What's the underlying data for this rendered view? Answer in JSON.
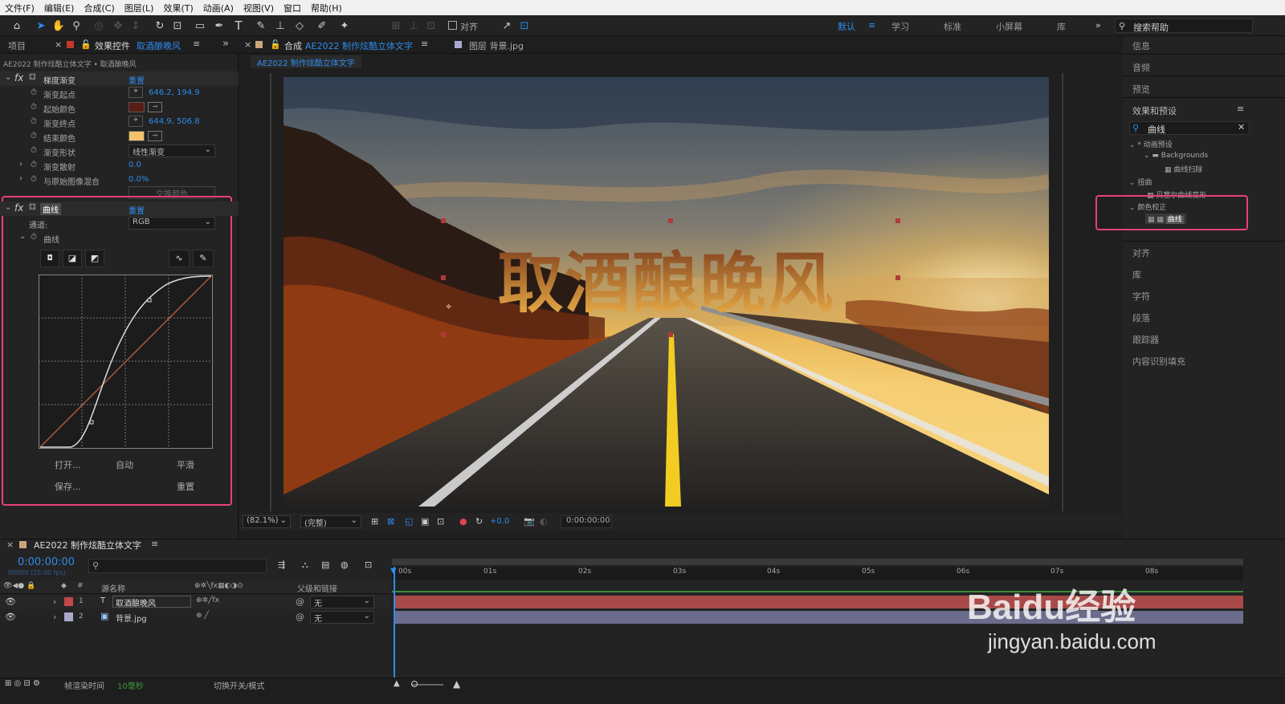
{
  "menu": [
    "文件(F)",
    "编辑(E)",
    "合成(C)",
    "图层(L)",
    "效果(T)",
    "动画(A)",
    "视图(V)",
    "窗口",
    "帮助(H)"
  ],
  "toolbar": {
    "align_label": "对齐",
    "workspaces": [
      "默认",
      "学习",
      "标准",
      "小屏幕",
      "库"
    ],
    "search_placeholder": "搜索帮助"
  },
  "left_panel": {
    "tab_project": "项目",
    "tab_effects": "效果控件",
    "layer_name": "取酒酿晚风",
    "breadcrumb": "AE2022 制作炫酷立体文字 • 取酒酿晚风",
    "ramp": {
      "name": "梯度渐变",
      "reset": "重置",
      "props": [
        {
          "label": "渐变起点",
          "value": "646.2, 194.9"
        },
        {
          "label": "起始颜色",
          "value": ""
        },
        {
          "label": "渐变终点",
          "value": "644.9, 506.8"
        },
        {
          "label": "结束颜色",
          "value": ""
        },
        {
          "label": "渐变形状",
          "value": "线性渐变"
        },
        {
          "label": "渐变散射",
          "value": "0.0"
        },
        {
          "label": "与原始图像混合",
          "value": "0.0%"
        }
      ],
      "swap_button": "交换颜色",
      "start_color": "#5a1d15",
      "end_color": "#f2c46a"
    },
    "curves": {
      "name": "曲线",
      "reset": "重置",
      "channel_label": "通道:",
      "channel_value": "RGB",
      "curve_label": "曲线",
      "buttons": [
        "打开...",
        "自动",
        "平滑",
        "保存...",
        "重置"
      ]
    }
  },
  "viewer": {
    "tab_comp_prefix": "合成",
    "tab_comp_name": "AE2022 制作炫酷立体文字",
    "tab_layer": "图层 背景.jpg",
    "comp_tag": "AE2022 制作炫酷立体文字",
    "title_text": "取酒酿晚风",
    "zoom": "(82.1%)",
    "resolution": "(完整)",
    "exposure": "+0.0",
    "timecode": "0:00:00:00"
  },
  "right_panel": {
    "sections": [
      "信息",
      "音频",
      "预览"
    ],
    "effects_title": "效果和预设",
    "search_value": "曲线",
    "tree": [
      {
        "label": "* 动画预设",
        "indent": 0
      },
      {
        "label": "Backgrounds",
        "indent": 1
      },
      {
        "label": "曲线扫除",
        "indent": 2
      },
      {
        "label": "扭曲",
        "indent": 0
      },
      {
        "label": "贝塞尔曲线变形",
        "indent": 2
      },
      {
        "label": "颜色校正",
        "indent": 0
      },
      {
        "label": "曲线",
        "indent": 2
      }
    ],
    "bottom_sections": [
      "对齐",
      "库",
      "字符",
      "段落",
      "跟踪器",
      "内容识别填充"
    ]
  },
  "timeline": {
    "comp_name": "AE2022 制作炫酷立体文字",
    "timecode": "0:00:00:00",
    "frame_info": "00000 (25.00 fps)",
    "col_source": "源名称",
    "col_parent": "父级和链接",
    "layers": [
      {
        "num": "1",
        "type": "T",
        "name": "取酒酿晚风",
        "parent": "无",
        "color": "#c04848"
      },
      {
        "num": "2",
        "type": "img",
        "name": "背景.jpg",
        "parent": "无",
        "color": "#a9a9d0"
      }
    ],
    "ticks": [
      "00s",
      "01s",
      "02s",
      "03s",
      "04s",
      "05s",
      "06s",
      "07s",
      "08s"
    ],
    "render_label": "帧渲染时间",
    "render_value": "10毫秒",
    "switch_label": "切换开关/模式"
  },
  "watermark": {
    "brand": "Baidu经验",
    "url": "jingyan.baidu.com"
  }
}
